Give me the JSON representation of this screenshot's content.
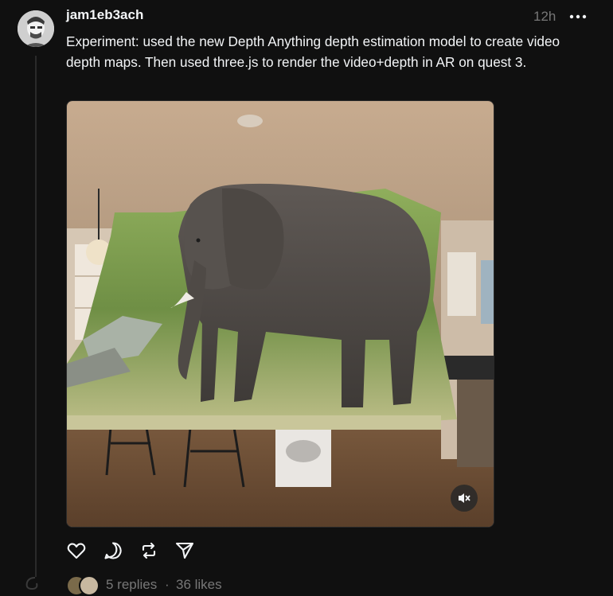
{
  "post": {
    "username": "jam1eb3ach",
    "timestamp": "12h",
    "text": "Experiment: used the new Depth Anything depth estimation model to create video depth maps. Then used three.js to render the video+depth in AR on quest 3."
  },
  "stats": {
    "replies": "5 replies",
    "separator": "·",
    "likes": "36 likes"
  },
  "icons": {
    "more": "more-horizontal-icon",
    "mute": "muted-speaker-icon",
    "like": "heart-icon",
    "reply": "comment-icon",
    "repost": "repost-icon",
    "share": "send-icon"
  },
  "colors": {
    "background": "#101010",
    "text": "#f3f5f7",
    "muted": "#777777",
    "line": "#2a2a2a"
  }
}
